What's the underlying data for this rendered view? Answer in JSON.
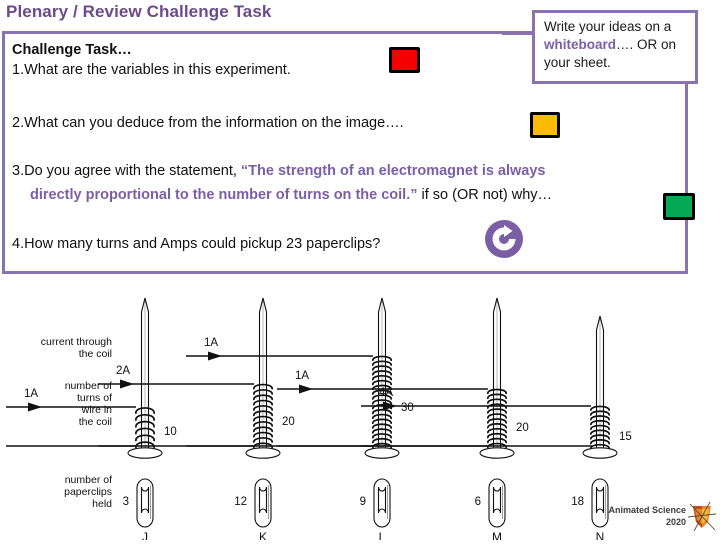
{
  "page_title": "Plenary / Review Challenge Task",
  "panel": {
    "task_heading": "Challenge Task…",
    "q1": "1.What are the variables in this experiment.",
    "q2": "2.What can you deduce from the information on the image….",
    "q3_prefix": "3.Do you agree with the statement,",
    "q3_quote_line1": "“The strength of an electromagnet is always",
    "q3_quote_line2": "directly proportional to the number of turns on the coil.”",
    "q3_suffix": "if so (OR not) why…",
    "q4": "4.How many turns and Amps could pickup 23 paperclips?"
  },
  "callout": {
    "text_before": "Write your ideas on a ",
    "highlight": "whiteboard",
    "text_after": "…. OR on your sheet."
  },
  "swatches": {
    "red": "#f40000",
    "yellow": "#fdbb06",
    "green": "#05a855"
  },
  "icons": {
    "rotate": "rotate-icon",
    "logo_mark": "animated-science-logo-mark"
  },
  "accent_color": "#7b5fa6",
  "border_color": "#8a72ad",
  "diagram": {
    "row_labels": {
      "current": "current through\nthe coil",
      "turns": "number of\nturns of\nwire in\nthe coil",
      "paperclips": "number of\npaperclips\nheld"
    },
    "setups": [
      {
        "id": "J",
        "current": "1A",
        "turns": "10",
        "paperclips": "3",
        "coil_turns": 10
      },
      {
        "id": "K",
        "current": "2A",
        "turns": "20",
        "paperclips": "12",
        "coil_turns": 20
      },
      {
        "id": "L",
        "current": "1A",
        "turns": "30",
        "paperclips": "9",
        "coil_turns": 30
      },
      {
        "id": "M",
        "current": "1A",
        "turns": "20",
        "paperclips": "6",
        "coil_turns": 20
      },
      {
        "id": "N",
        "current": "4A",
        "turns": "15",
        "paperclips": "18",
        "coil_turns": 15
      }
    ]
  },
  "footer": {
    "brand_line1": "Animated Science",
    "brand_line2": "2020"
  }
}
